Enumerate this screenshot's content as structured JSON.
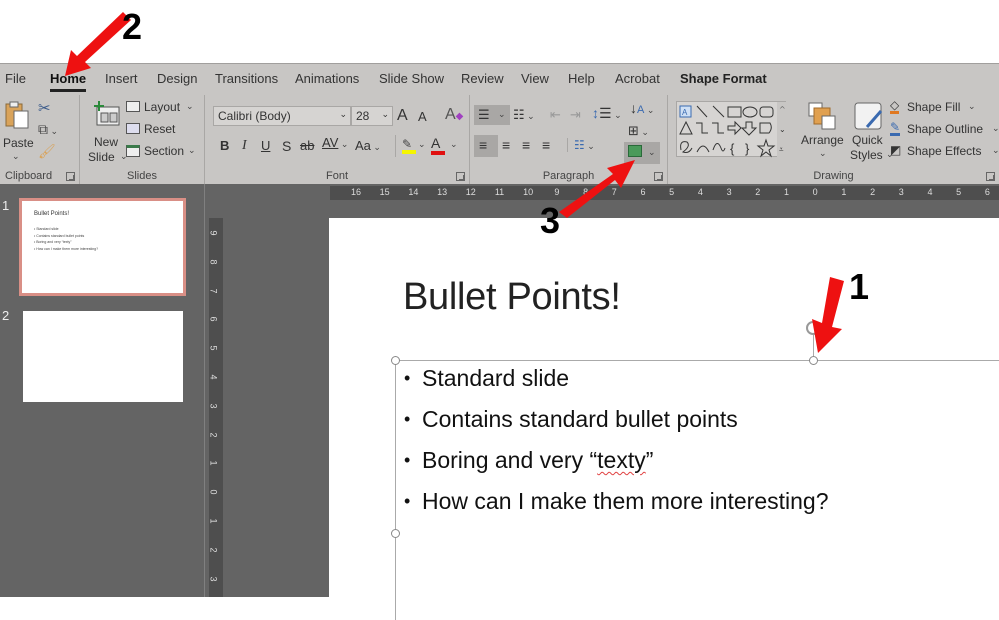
{
  "annotations": {
    "arrow_1_label": "1",
    "arrow_2_label": "2",
    "arrow_3_label": "3",
    "arrow_color": "#ee1111"
  },
  "ribbon": {
    "tabs": [
      {
        "label": "File"
      },
      {
        "label": "Home",
        "active": true
      },
      {
        "label": "Insert"
      },
      {
        "label": "Design"
      },
      {
        "label": "Transitions"
      },
      {
        "label": "Animations"
      },
      {
        "label": "Slide Show"
      },
      {
        "label": "Review"
      },
      {
        "label": "View"
      },
      {
        "label": "Help"
      },
      {
        "label": "Acrobat"
      },
      {
        "label": "Shape Format"
      }
    ],
    "clipboard": {
      "label": "Clipboard",
      "paste": "Paste",
      "cut_icon": "scissors-icon",
      "copy_icon": "copy-icon",
      "format_painter_icon": "format-painter-icon"
    },
    "slides": {
      "label": "Slides",
      "new_slide_line1": "New",
      "new_slide_line2": "Slide",
      "layout": "Layout",
      "reset": "Reset",
      "section": "Section"
    },
    "font": {
      "label": "Font",
      "font_name": "Calibri (Body)",
      "font_size": "28",
      "grow": "A",
      "shrink": "A",
      "bold": "B",
      "italic": "I",
      "underline": "U",
      "shadow": "S",
      "strikethrough": "ab",
      "spacing": "AV",
      "change_case": "Aa",
      "font_color": "A",
      "highlight_color": "#f5f500",
      "font_color_bar": "#e01010"
    },
    "paragraph": {
      "label": "Paragraph",
      "text_direction_icon": "text-direction-icon",
      "align_text_icon": "align-text-icon",
      "smartart_icon": "convert-to-smartart-icon"
    },
    "drawing": {
      "label": "Drawing",
      "arrange": "Arrange",
      "quick_styles_line1": "Quick",
      "quick_styles_line2": "Styles",
      "shape_fill": "Shape Fill",
      "shape_outline": "Shape Outline",
      "shape_effects": "Shape Effects"
    }
  },
  "thumbnails": [
    {
      "number": "1",
      "title": "Bullet Points!",
      "bullets": [
        "Standard slide",
        "Contains standard bullet points",
        "Boring and very “texty”",
        "How can I make them more interesting?"
      ],
      "selected": true
    },
    {
      "number": "2",
      "title": "",
      "bullets": [],
      "selected": false
    }
  ],
  "rulers": {
    "horizontal": [
      "16",
      "15",
      "14",
      "13",
      "12",
      "11",
      "10",
      "9",
      "8",
      "7",
      "6",
      "5",
      "4",
      "3",
      "2",
      "1",
      "0",
      "1",
      "2",
      "3",
      "4",
      "5",
      "6"
    ],
    "vertical": [
      "9",
      "8",
      "7",
      "6",
      "5",
      "4",
      "3",
      "2",
      "1",
      "0",
      "1",
      "2",
      "3"
    ]
  },
  "slide": {
    "title": "Bullet Points!",
    "bullets": [
      {
        "text": "Standard slide"
      },
      {
        "text": "Contains standard bullet points"
      },
      {
        "pre": "Boring and very “",
        "squiggle": "texty",
        "post": "”"
      },
      {
        "text": "How can I make them more interesting?"
      }
    ]
  }
}
